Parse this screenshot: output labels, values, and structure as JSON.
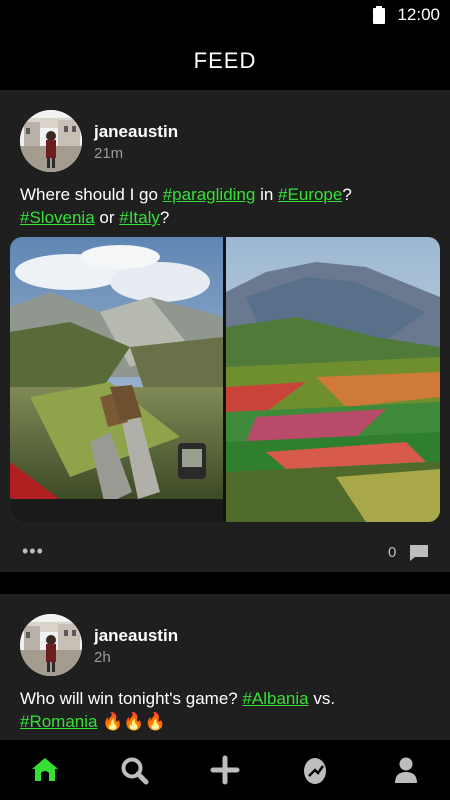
{
  "status_bar": {
    "time": "12:00"
  },
  "header": {
    "title": "FEED"
  },
  "posts": [
    {
      "username": "janeaustin",
      "time_ago": "21m",
      "text": {
        "p1": "Where should I go ",
        "t1": "#paragliding",
        "p2": " in ",
        "t2": "#Europe",
        "p3": "?",
        "t3": "#Slovenia",
        "p4": " or ",
        "t4": "#Italy",
        "p5": "?"
      },
      "comment_count": "0",
      "more_label": "•••",
      "photos": [
        "paragliding-mountain-photo",
        "italy-flower-valley-photo"
      ]
    },
    {
      "username": "janeaustin",
      "time_ago": "2h",
      "text": {
        "p1": "Who will win tonight's game? ",
        "t1": "#Albania",
        "p2": " vs.",
        "t2": "#Romania",
        "p3": " 🔥🔥🔥"
      }
    }
  ],
  "bottom_nav": {
    "items": [
      "home-icon",
      "search-icon",
      "add-icon",
      "egg-icon",
      "profile-icon"
    ],
    "active_color": "#35e034",
    "inactive_color": "#bdbdbd"
  },
  "colors": {
    "hashtag": "#35e034",
    "card": "#1f1f1f",
    "background": "#000000"
  }
}
